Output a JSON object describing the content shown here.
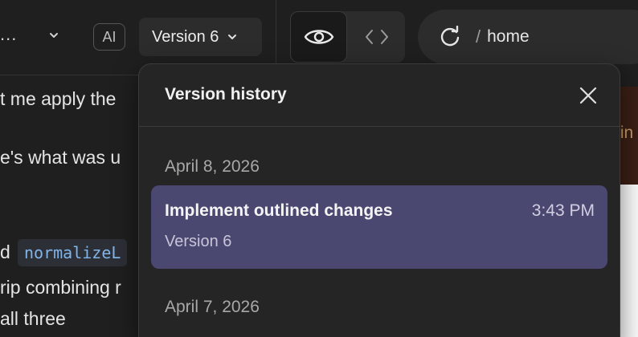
{
  "toolbar": {
    "ellipsis": "...",
    "ai_badge": "AI",
    "version_button": "Version 6"
  },
  "url_bar": {
    "separator": "/",
    "path": "home"
  },
  "chat": {
    "lines": [
      "t me apply the",
      "e's what was u",
      "d",
      "rip combining r",
      "all three"
    ],
    "code_chip": "normalizeL"
  },
  "preview": {
    "fragment": "tin"
  },
  "version_history": {
    "title": "Version history",
    "groups": [
      {
        "date": "April 8, 2026",
        "items": [
          {
            "title": "Implement outlined changes",
            "time": "3:43 PM",
            "version": "Version 6",
            "selected": true
          }
        ]
      },
      {
        "date": "April 7, 2026",
        "items": []
      }
    ]
  },
  "colors": {
    "background": "#1f1f1f",
    "popover": "#252525",
    "selected_item": "#4a4870",
    "code_text": "#82b4e8"
  },
  "icons": {
    "chevron": "chevron-down-icon",
    "eye": "eye-icon",
    "code": "code-icon",
    "reload": "reload-icon",
    "close": "close-icon"
  }
}
